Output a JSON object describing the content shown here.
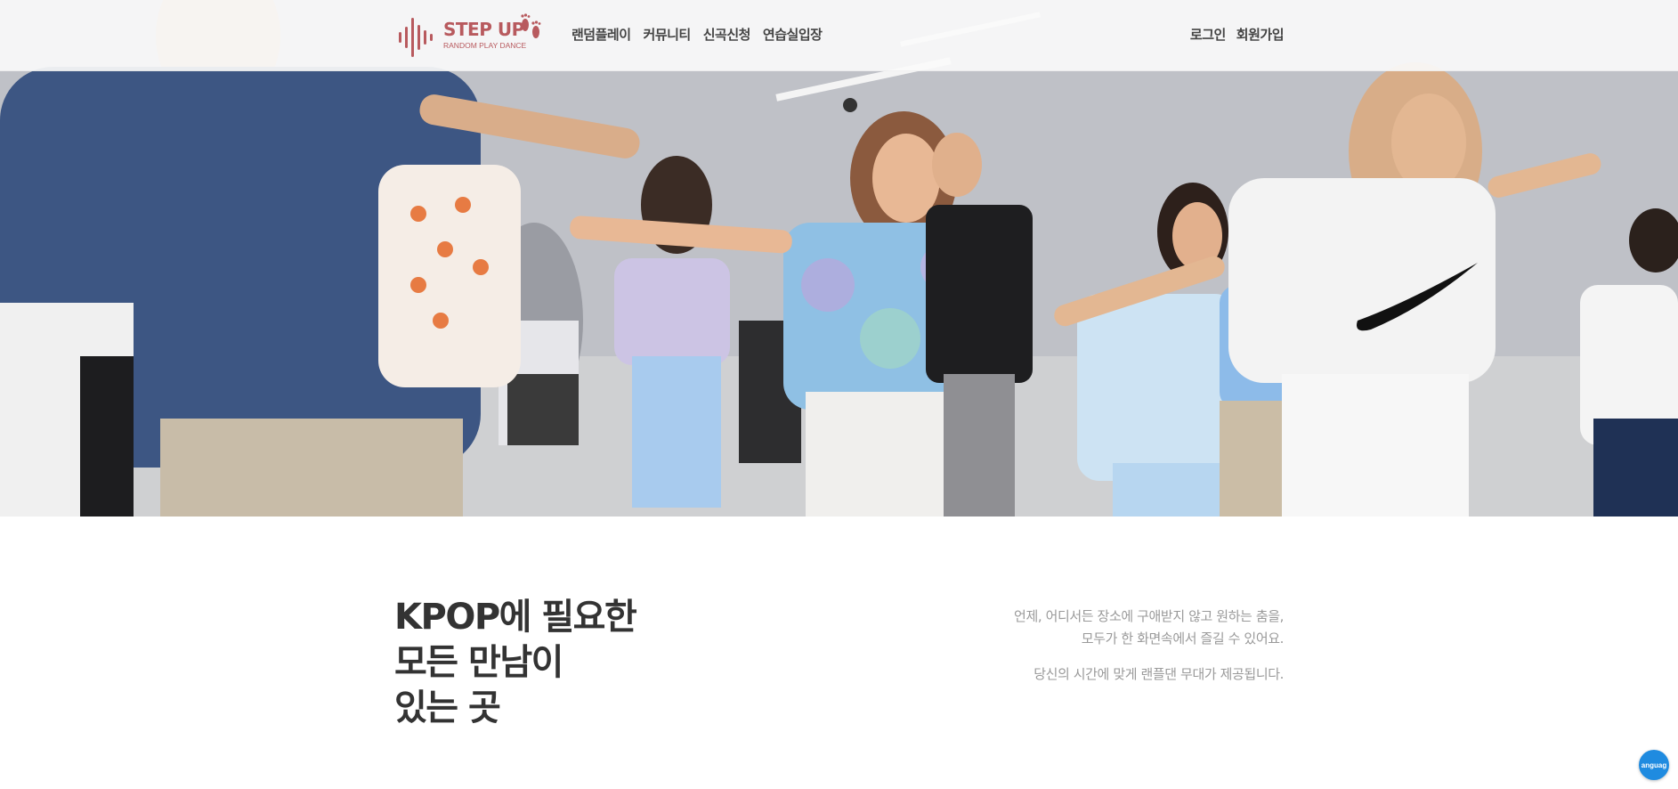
{
  "header": {
    "logo": {
      "title": "STEP UP",
      "subtitle": "RANDOM PLAY DANCE",
      "brand_color": "#b85a5e"
    },
    "nav": [
      {
        "label": "랜덤플레이"
      },
      {
        "label": "커뮤니티"
      },
      {
        "label": "신곡신청"
      },
      {
        "label": "연습실입장"
      }
    ],
    "auth": {
      "login_label": "로그인",
      "signup_label": "회원가입"
    }
  },
  "hero": {
    "image": "dance-class-photo"
  },
  "main": {
    "headline": [
      "KPOP에 필요한",
      "모든 만남이",
      "있는 곳"
    ],
    "description": [
      "언제, 어디서든 장소에 구애받지 않고 원하는 춤을,",
      "모두가 한 화면속에서 즐길 수 있어요.",
      "당신의 시간에 맞게 랜플댄 무대가 제공됩니다."
    ]
  },
  "language_button": {
    "label": "anguag",
    "color": "#1f8be0"
  }
}
